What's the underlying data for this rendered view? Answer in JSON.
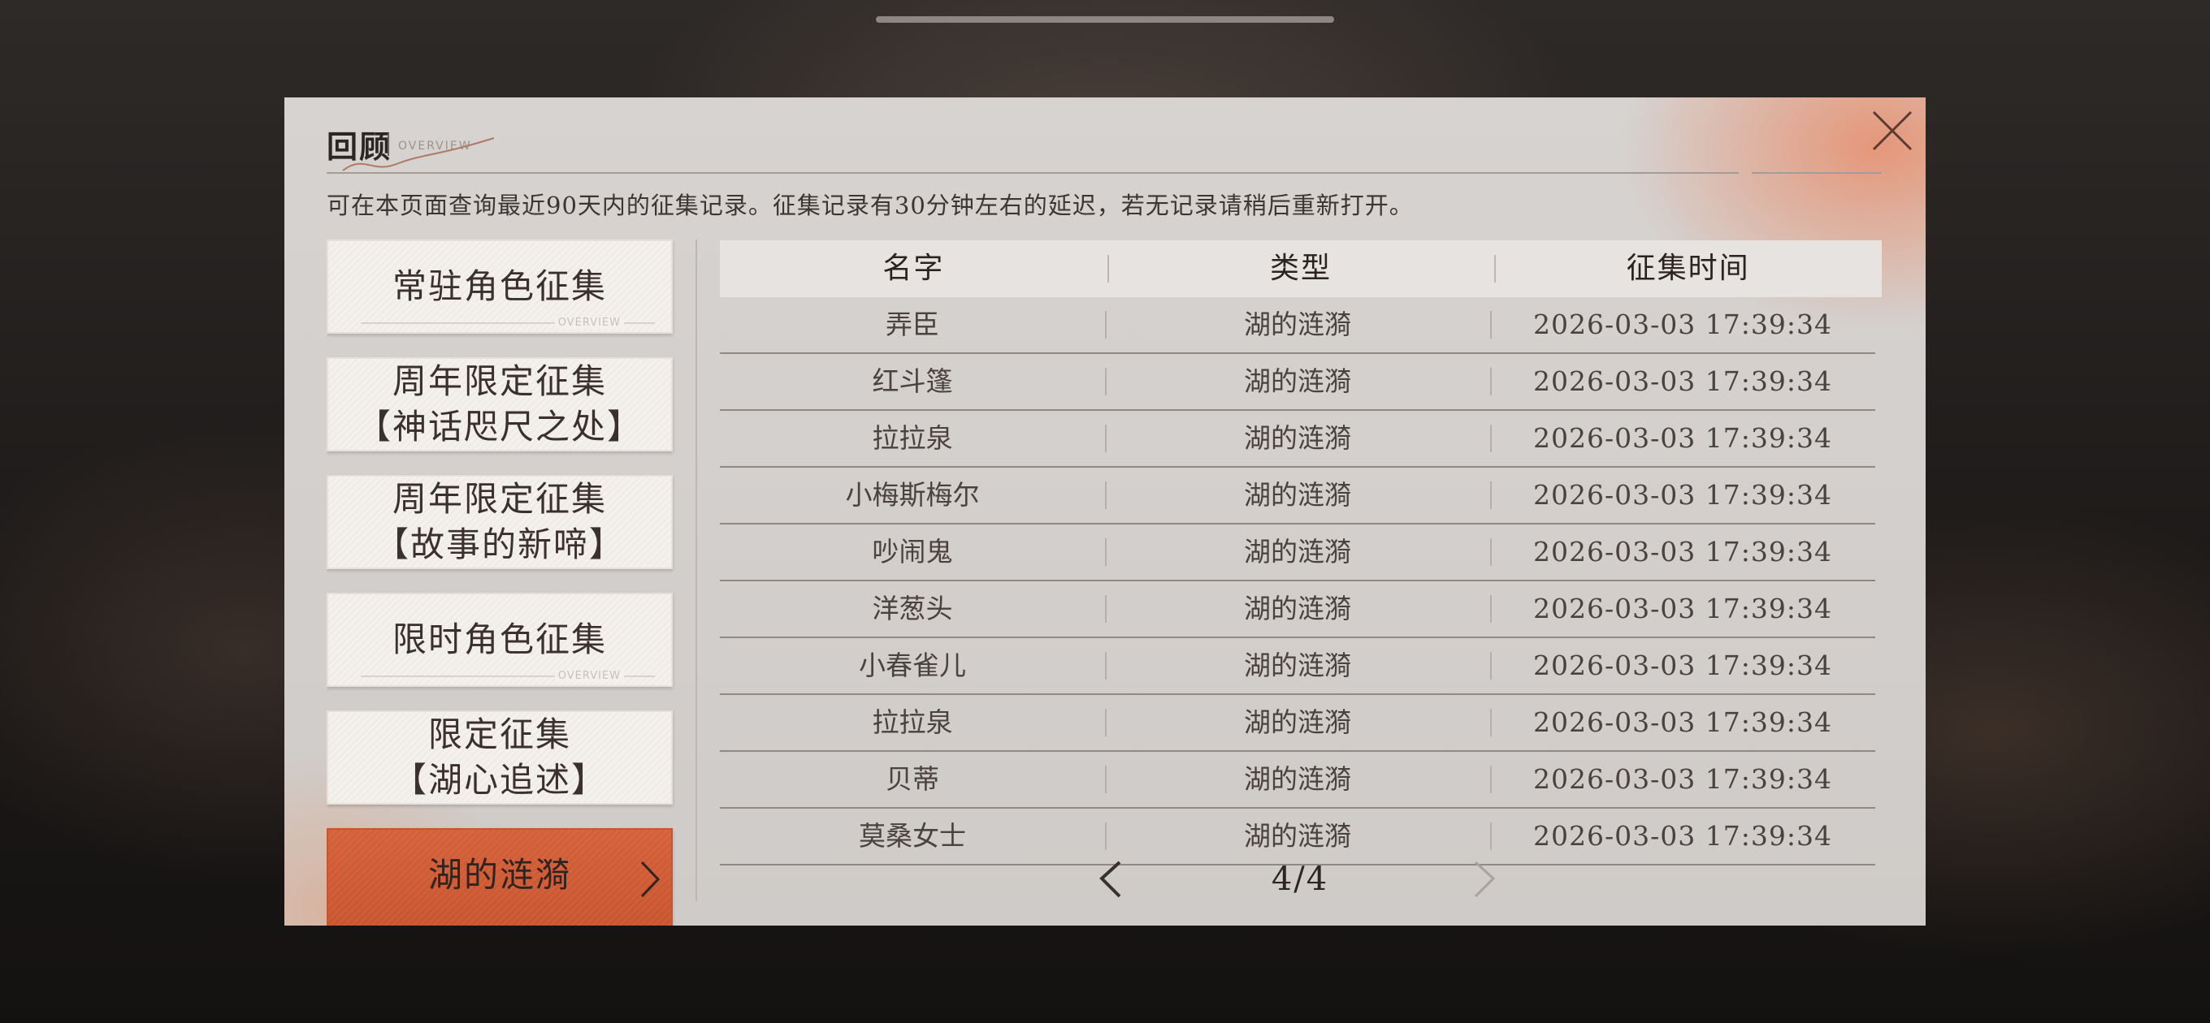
{
  "header": {
    "title": "回顾",
    "subtitle": "OVERVIEW"
  },
  "notice": "可在本页面查询最近90天内的征集记录。征集记录有30分钟左右的延迟，若无记录请稍后重新打开。",
  "sidebar": {
    "items": [
      {
        "lines": [
          "常驻角色征集"
        ],
        "decoration": "OVERVIEW",
        "active": false
      },
      {
        "lines": [
          "周年限定征集",
          "【神话咫尺之处】"
        ],
        "active": false
      },
      {
        "lines": [
          "周年限定征集",
          "【故事的新啼】"
        ],
        "active": false
      },
      {
        "lines": [
          "限时角色征集"
        ],
        "decoration": "OVERVIEW",
        "active": false
      },
      {
        "lines": [
          "限定征集",
          "【湖心追述】"
        ],
        "active": false
      },
      {
        "lines": [
          "湖的涟漪"
        ],
        "active": true
      }
    ]
  },
  "table": {
    "headers": [
      "名字",
      "类型",
      "征集时间"
    ],
    "rows": [
      [
        "弄臣",
        "湖的涟漪",
        "2026-03-03 17:39:34"
      ],
      [
        "红斗篷",
        "湖的涟漪",
        "2026-03-03 17:39:34"
      ],
      [
        "拉拉泉",
        "湖的涟漪",
        "2026-03-03 17:39:34"
      ],
      [
        "小梅斯梅尔",
        "湖的涟漪",
        "2026-03-03 17:39:34"
      ],
      [
        "吵闹鬼",
        "湖的涟漪",
        "2026-03-03 17:39:34"
      ],
      [
        "洋葱头",
        "湖的涟漪",
        "2026-03-03 17:39:34"
      ],
      [
        "小春雀儿",
        "湖的涟漪",
        "2026-03-03 17:39:34"
      ],
      [
        "拉拉泉",
        "湖的涟漪",
        "2026-03-03 17:39:34"
      ],
      [
        "贝蒂",
        "湖的涟漪",
        "2026-03-03 17:39:34"
      ],
      [
        "莫桑女士",
        "湖的涟漪",
        "2026-03-03 17:39:34"
      ]
    ]
  },
  "pager": {
    "current": 4,
    "total": 4,
    "text": "4/4"
  },
  "colors": {
    "accent": "#d0592f",
    "panel": "#d3d0ce",
    "text": "#3a302d"
  },
  "icons": {
    "close": "close-icon",
    "prev": "chevron-left-icon",
    "next": "chevron-right-icon",
    "active_item": "chevron-right-icon"
  }
}
